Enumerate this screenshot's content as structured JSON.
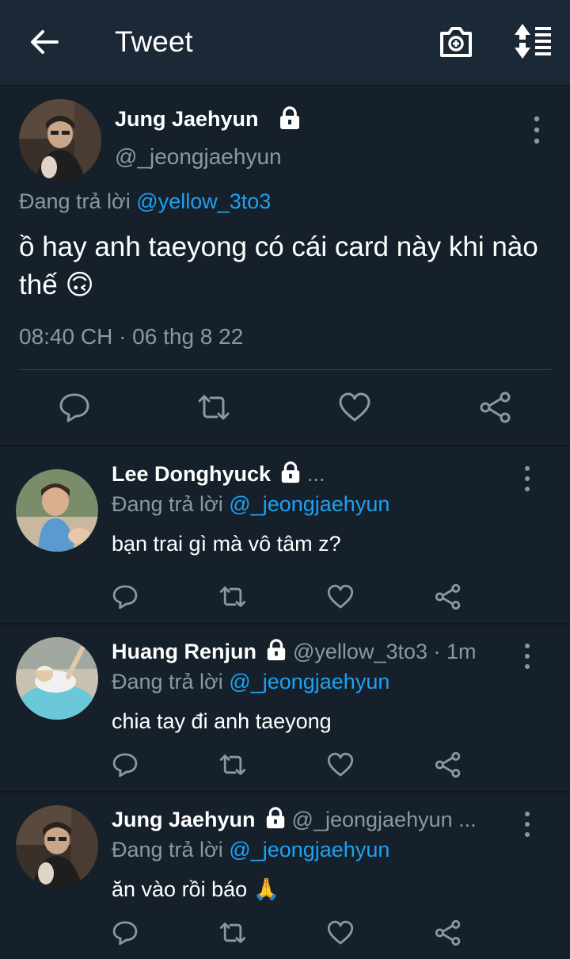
{
  "header": {
    "title": "Tweet",
    "back_icon": "arrow-left-icon",
    "camera_icon": "camera-plus-icon",
    "sort_icon": "sort-list-icon"
  },
  "main_tweet": {
    "name": "Jung Jaehyun",
    "handle": "@_jeongjaehyun",
    "replying_prefix": "Đang trả lời",
    "replying_to": "@yellow_3to3",
    "text": "ồ hay anh taeyong có cái card này khi nào thế 🙃",
    "timestamp": "08:40 CH · 06 thg 8 22"
  },
  "replies": [
    {
      "name": "Lee Donghyuck",
      "handle_meta": "...",
      "replying_prefix": "Đang trả lời",
      "replying_to": "@_jeongjaehyun",
      "text": "bạn trai gì mà vô tâm z?"
    },
    {
      "name": "Huang Renjun",
      "handle_meta": "@yellow_3to3 · 1m",
      "replying_prefix": "Đang trả lời",
      "replying_to": "@_jeongjaehyun",
      "text": "chia tay đi anh taeyong"
    },
    {
      "name": "Jung Jaehyun",
      "handle_meta": "@_jeongjaehyun ...",
      "replying_prefix": "Đang trả lời",
      "replying_to": "@_jeongjaehyun",
      "text": "ăn vào rồi báo 🙏"
    }
  ],
  "colors": {
    "background": "#15202b",
    "header": "#1b2836",
    "secondary_text": "#8899a6",
    "link": "#1da1f2",
    "divider": "#38444d"
  }
}
